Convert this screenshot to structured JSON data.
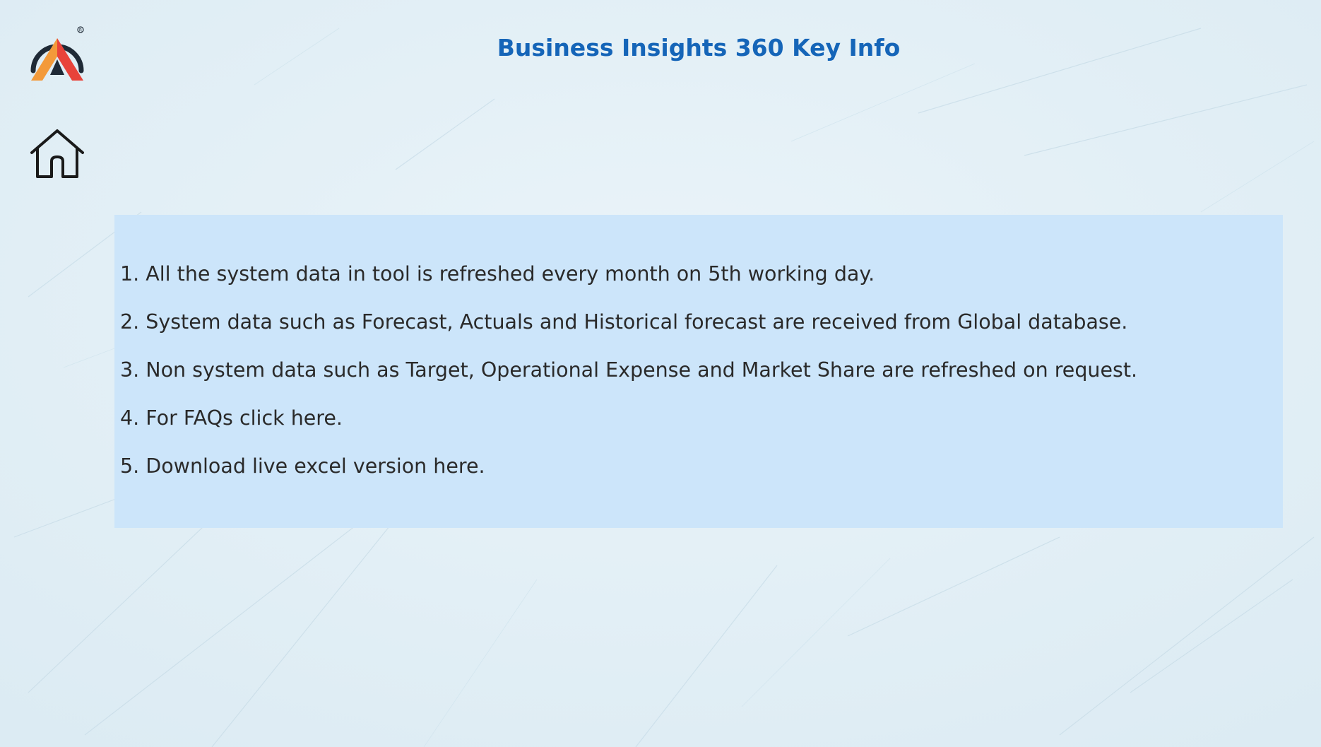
{
  "page": {
    "title": "Business Insights 360 Key Info"
  },
  "nav": {
    "logo_icon": "atliq-logo-icon",
    "home_icon": "home-icon"
  },
  "info": {
    "items": [
      "1. All the system data in tool is refreshed every month on 5th working day.",
      "2.  System data such as Forecast, Actuals and Historical forecast are received from Global database.",
      "3.  Non system data such as Target, Operational Expense and Market Share are refreshed on request.",
      "4. For FAQs click here.",
      "5. Download live excel version here."
    ]
  },
  "colors": {
    "title": "#1565b8",
    "panel": "#cce5fa",
    "background": "#e4f0f6",
    "text": "#2a2a2a",
    "logo_arc": "#1f2a36",
    "logo_red": "#e8433a",
    "logo_orange": "#f39a3a"
  }
}
